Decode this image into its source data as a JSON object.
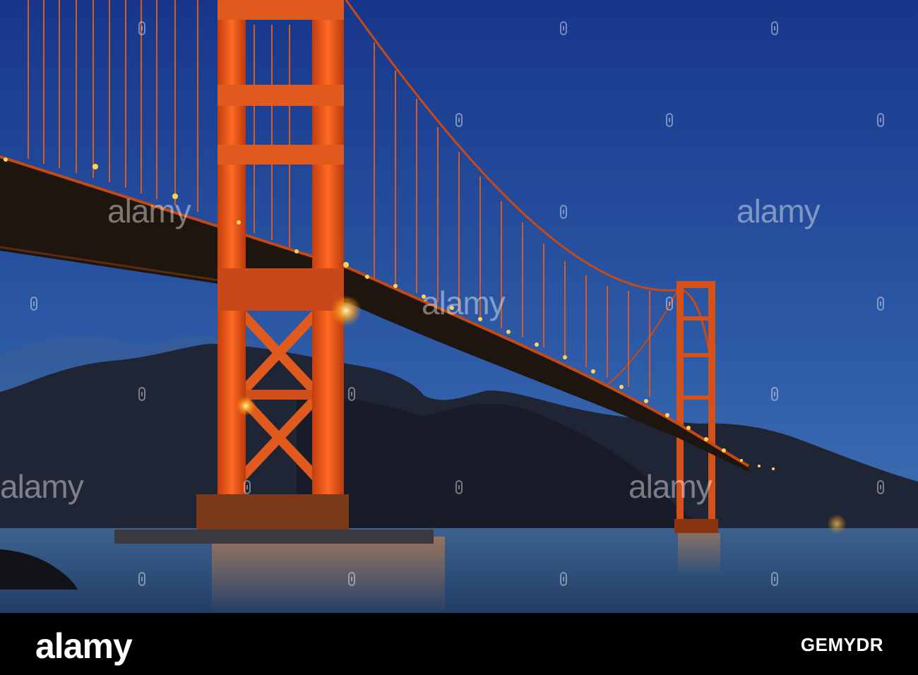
{
  "scene": {
    "subject": "Golden Gate Bridge at dusk",
    "colors": {
      "sky_top": "#1a3f95",
      "sky_bottom": "#3b6cb1",
      "bridge": "#e0541b",
      "lights": "#ffc24a",
      "water": "#2c4f7f",
      "hills": "#202838"
    }
  },
  "watermark": {
    "text": "alamy",
    "glyph": "alamy-logo-icon"
  },
  "footer": {
    "logo_text": "alamy",
    "image_id": "GEMYDR"
  }
}
